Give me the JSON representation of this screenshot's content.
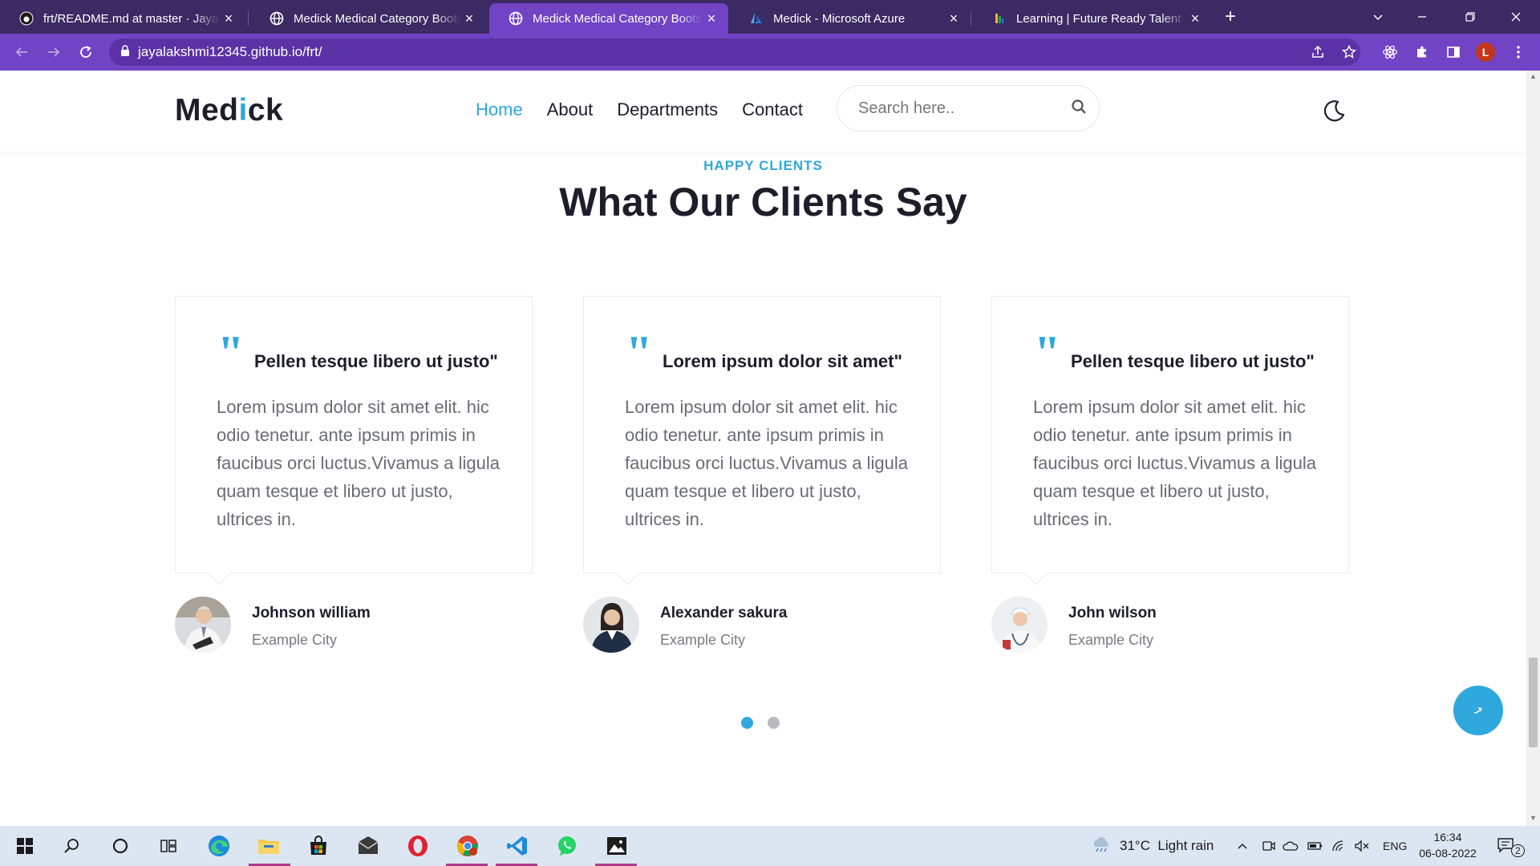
{
  "browser": {
    "tabs": [
      {
        "title": "frt/README.md at master · Jayalakshmi",
        "icon": "github-icon"
      },
      {
        "title": "Medick Medical Category Bootstrap",
        "icon": "globe-icon"
      },
      {
        "title": "Medick Medical Category Bootstrap",
        "icon": "globe-icon",
        "active": true
      },
      {
        "title": "Medick - Microsoft Azure",
        "icon": "azure-icon"
      },
      {
        "title": "Learning | Future Ready Talent",
        "icon": "learning-icon"
      }
    ],
    "new_tab": "+",
    "close_glyph": "×",
    "url": "jayalakshmi12345.github.io/frt/",
    "profile_initial": "L"
  },
  "site": {
    "logo_part1": "Med",
    "logo_accent": "i",
    "logo_part2": "ck",
    "nav": [
      "Home",
      "About",
      "Departments",
      "Contact"
    ],
    "search_placeholder": "Search here.."
  },
  "section": {
    "tag": "HAPPY CLIENTS",
    "title": "What Our Clients Say"
  },
  "testimonials": [
    {
      "quote_mark": "\"",
      "title": "Pellen tesque libero ut justo\"",
      "body": "Lorem ipsum dolor sit amet elit. hic odio tenetur. ante ipsum primis in faucibus orci luctus.Vivamus a ligula quam tesque et libero ut justo, ultrices in.",
      "name": "Johnson william",
      "city": "Example City"
    },
    {
      "quote_mark": "\"",
      "title": "Lorem ipsum dolor sit amet\"",
      "body": "Lorem ipsum dolor sit amet elit. hic odio tenetur. ante ipsum primis in faucibus orci luctus.Vivamus a ligula quam tesque et libero ut justo, ultrices in.",
      "name": "Alexander sakura",
      "city": "Example City"
    },
    {
      "quote_mark": "\"",
      "title": "Pellen tesque libero ut justo\"",
      "body": "Lorem ipsum dolor sit amet elit. hic odio tenetur. ante ipsum primis in faucibus orci luctus.Vivamus a ligula quam tesque et libero ut justo, ultrices in.",
      "name": "John wilson",
      "city": "Example City"
    }
  ],
  "carousel": {
    "pages": 2,
    "active": 1
  },
  "taskbar": {
    "weather": "31°C  Light rain",
    "lang": "ENG",
    "time": "16:34",
    "date": "06-08-2022",
    "notifications": "2"
  },
  "colors": {
    "accent": "#2fa8dd",
    "tabbar": "#3b2a63",
    "toolbar": "#7044c4",
    "heading": "#1d1d2b"
  }
}
